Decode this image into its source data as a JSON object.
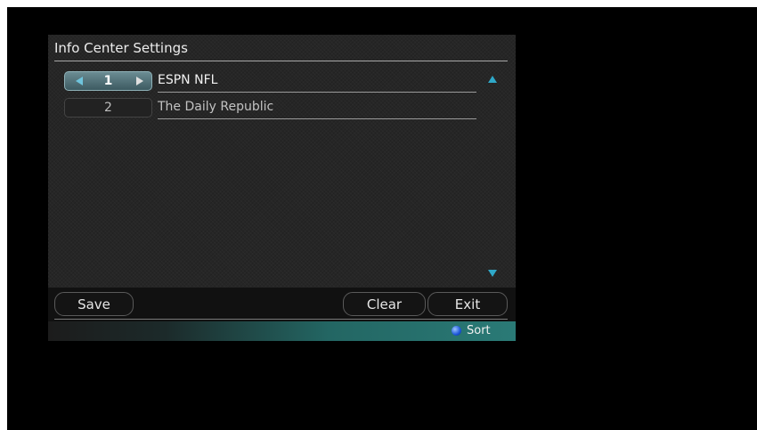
{
  "window": {
    "title": "Info Center Settings"
  },
  "list": {
    "items": [
      {
        "number": "1",
        "name": "ESPN NFL",
        "selected": true
      },
      {
        "number": "2",
        "name": "The Daily Republic",
        "selected": false
      }
    ]
  },
  "buttons": {
    "save": "Save",
    "clear": "Clear",
    "exit": "Exit"
  },
  "status_bar": {
    "sort_label": "Sort",
    "sort_key_color": "#1b55d8"
  },
  "colors": {
    "accent": "#2fa8c8",
    "panel": "#262626",
    "status_gradient_end": "#2a7a76"
  }
}
